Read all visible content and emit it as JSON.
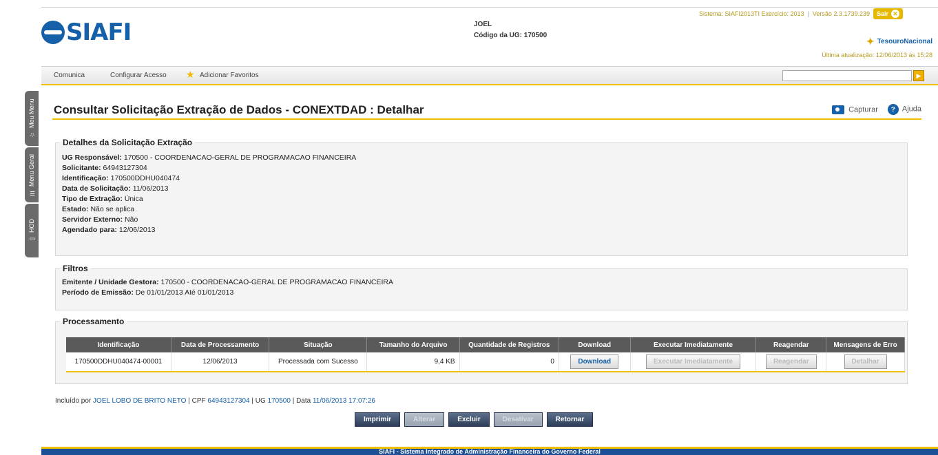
{
  "sidebar": {
    "tabs": [
      {
        "label": "Meu Menu"
      },
      {
        "label": "Menu Geral"
      },
      {
        "label": "HOD"
      }
    ]
  },
  "header": {
    "logo": "SIAFI",
    "user_name": "JOEL",
    "ug_label": "Código da UG:",
    "ug_value": "170500",
    "system_info": "Sistema: SIAFI2013TI Exercício: 2013",
    "version": "Versão 2.3.1739.239",
    "exit_label": "Sair",
    "tesouro": "TesouroNacional",
    "last_update": "Última atualização: 12/06/2013 às 15:28"
  },
  "menu": {
    "items": [
      {
        "label": "Comunica"
      },
      {
        "label": "Configurar Acesso"
      },
      {
        "label": "Adicionar Favoritos"
      }
    ],
    "search_placeholder": ""
  },
  "page": {
    "title": "Consultar Solicitação Extração de Dados - CONEXTDAD : Detalhar",
    "capture": "Capturar",
    "help": "Ajuda"
  },
  "details": {
    "legend": "Detalhes da Solicitação Extração",
    "rows": [
      {
        "label": "UG Responsável:",
        "value": "170500 - COORDENACAO-GERAL DE PROGRAMACAO FINANCEIRA"
      },
      {
        "label": "Solicitante:",
        "value": "64943127304"
      },
      {
        "label": "Identificação:",
        "value": "170500DDHU040474"
      },
      {
        "label": "Data de Solicitação:",
        "value": "11/06/2013"
      },
      {
        "label": "Tipo de Extração:",
        "value": "Única"
      },
      {
        "label": "Estado:",
        "value": "Não se aplica"
      },
      {
        "label": "Servidor Externo:",
        "value": "Não"
      },
      {
        "label": "Agendado para:",
        "value": "12/06/2013"
      }
    ]
  },
  "filters": {
    "legend": "Filtros",
    "emitente_label": "Emitente / Unidade Gestora:",
    "emitente_value": "170500 - COORDENACAO-GERAL DE PROGRAMACAO FINANCEIRA",
    "periodo_label": "Período de Emissão:",
    "de_label": "De",
    "de_value": "01/01/2013",
    "ate_label": "Até",
    "ate_value": "01/01/2013"
  },
  "processing": {
    "legend": "Processamento",
    "headers": [
      "Identificação",
      "Data de Processamento",
      "Situação",
      "Tamanho do Arquivo",
      "Quantidade de Registros",
      "Download",
      "Executar Imediatamente",
      "Reagendar",
      "Mensagens de Erro"
    ],
    "row": {
      "id": "170500DDHU040474-00001",
      "date": "12/06/2013",
      "status": "Processada com Sucesso",
      "size": "9,4 KB",
      "count": "0",
      "download": "Download",
      "execute": "Executar Imediatamente",
      "reschedule": "Reagendar",
      "details": "Detalhar"
    }
  },
  "footer_info": {
    "included_by": "Incluído por",
    "user": "JOEL LOBO DE BRITO NETO",
    "cpf_label": "| CPF",
    "cpf": "64943127304",
    "ug_label": "| UG",
    "ug": "170500",
    "data_label": "| Data",
    "date": "11/06/2013 17:07:26"
  },
  "buttons": {
    "print": "Imprimir",
    "edit": "Alterar",
    "delete": "Excluir",
    "deactivate": "Desativar",
    "back": "Retornar"
  },
  "footer": {
    "text": "SIAFI - Sistema Integrado de Administração Financeira do Governo Federal"
  },
  "colors": {
    "brand": "#1560a8",
    "accent": "#f0c000",
    "button_dark": "#2f3e58"
  }
}
